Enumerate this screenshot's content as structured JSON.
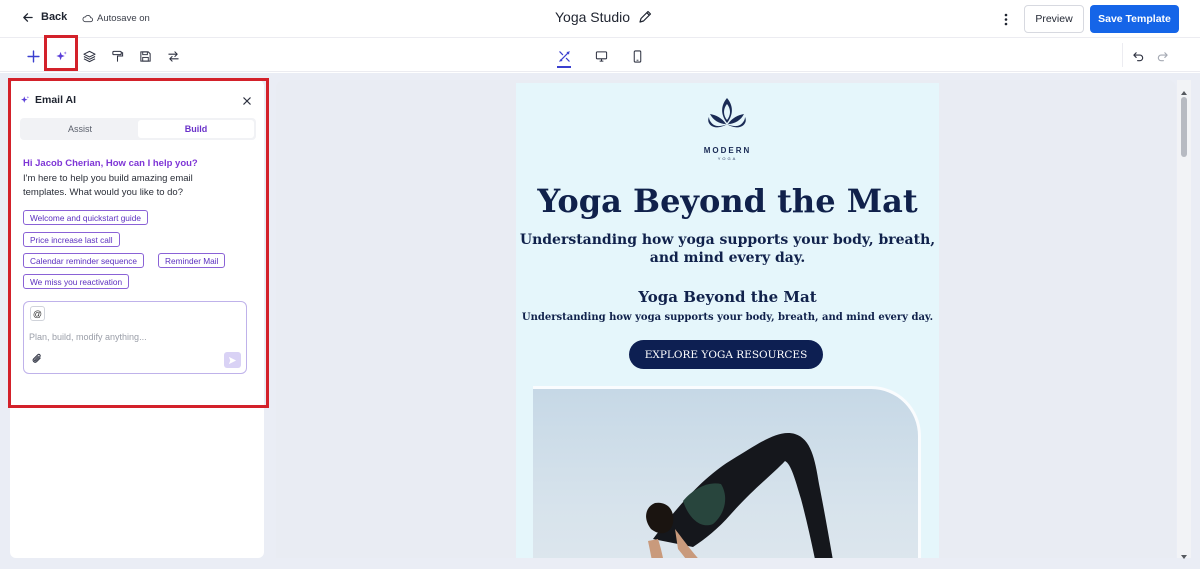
{
  "header": {
    "back_label": "Back",
    "autosave_label": "Autosave on",
    "title": "Yoga Studio",
    "preview_label": "Preview",
    "save_label": "Save Template"
  },
  "toolbar": {
    "left_tools": [
      "plus-icon",
      "sparkle-icon",
      "layers-icon",
      "paint-roller-icon",
      "save-icon",
      "swap-icon"
    ],
    "device_tools": [
      "tools-icon",
      "desktop-icon",
      "mobile-icon"
    ],
    "history_tools": [
      "undo-icon",
      "redo-icon"
    ],
    "accent_color": "#3a3fcf"
  },
  "ai_panel": {
    "title": "Email AI",
    "tabs": [
      {
        "label": "Assist",
        "active": false
      },
      {
        "label": "Build",
        "active": true
      }
    ],
    "greeting": "Hi Jacob Cherian, How can I help you?",
    "intro": "I'm here to help you build amazing email templates. What would you like to do?",
    "suggestions": [
      "Welcome and quickstart guide",
      "Price increase last call",
      "Calendar reminder sequence",
      "Reminder Mail",
      "We miss you reactivation"
    ],
    "mention_label": "@",
    "input_placeholder": "Plan, build, modify anything...",
    "accent_color": "#7e35d6",
    "highlight_color": "#d3212a"
  },
  "email": {
    "logo_text": "MODERN",
    "logo_subtext": "YOGA",
    "headline": "Yoga Beyond the Mat",
    "subheadline": "Understanding how yoga supports your body, breath, and mind every day.",
    "headline2": "Yoga Beyond the Mat",
    "subheadline2": "Understanding how yoga supports your body, breath, and mind every day.",
    "cta_label": "EXPLORE YOGA RESOURCES",
    "background_color": "#e5f6fb",
    "ink_color": "#10214b"
  },
  "brand": {
    "primary": "#1565e8"
  }
}
